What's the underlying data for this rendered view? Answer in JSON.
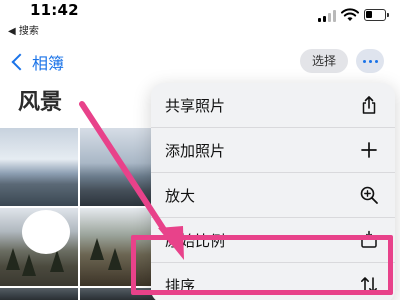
{
  "status_bar": {
    "time": "11:42",
    "back_app": "◀ 搜索"
  },
  "nav": {
    "back_label": "相簿",
    "select_label": "选择"
  },
  "album": {
    "title": "风景"
  },
  "menu": {
    "items": [
      {
        "label": "共享照片",
        "icon": "share-icon"
      },
      {
        "label": "添加照片",
        "icon": "plus-icon"
      },
      {
        "label": "放大",
        "icon": "zoom-in-icon"
      },
      {
        "label": "原始比例",
        "icon": "aspect-ratio-icon"
      },
      {
        "label": "排序",
        "icon": "sort-icon"
      }
    ]
  },
  "annotation": {
    "color": "#e8428a",
    "target": "排序"
  },
  "colors": {
    "accent": "#1a73e8",
    "annotation": "#e8428a"
  }
}
